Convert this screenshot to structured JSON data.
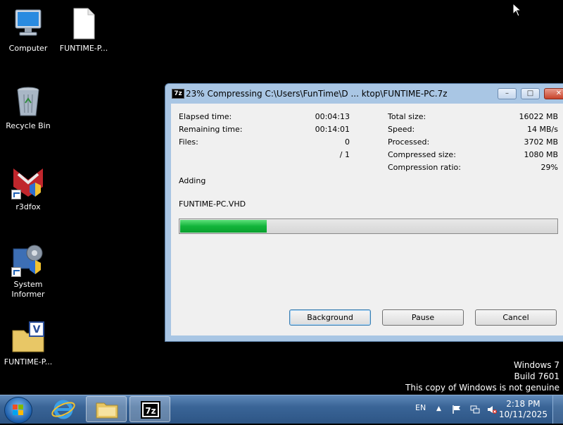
{
  "desktop": {
    "icons": [
      {
        "label": "Computer",
        "icon": "computer-icon"
      },
      {
        "label": "FUNTIME-P...",
        "icon": "blank-file-icon"
      },
      {
        "label": "Recycle Bin",
        "icon": "recycle-bin-icon"
      },
      {
        "label": "r3dfox",
        "icon": "r3dfox-icon"
      },
      {
        "label_line1": "System",
        "label_line2": "Informer",
        "icon": "system-informer-icon"
      },
      {
        "label": "FUNTIME-P...",
        "icon": "vhd-file-icon"
      }
    ],
    "watermark": {
      "line1": "Windows 7",
      "line2": "Build 7601",
      "line3": "This copy of Windows is not genuine"
    }
  },
  "window": {
    "app_icon_text": "7z",
    "title": "23% Compressing C:\\Users\\FunTime\\D ... ktop\\FUNTIME-PC.7z",
    "stats_left": [
      {
        "label": "Elapsed time:",
        "value": "00:04:13"
      },
      {
        "label": "Remaining time:",
        "value": "00:14:01"
      },
      {
        "label": "Files:",
        "value": "0"
      },
      {
        "label": "",
        "value": "/ 1"
      }
    ],
    "stats_right": [
      {
        "label": "Total size:",
        "value": "16022 MB"
      },
      {
        "label": "Speed:",
        "value": "14 MB/s"
      },
      {
        "label": "Processed:",
        "value": "3702 MB"
      },
      {
        "label": "Compressed size:",
        "value": "1080 MB"
      },
      {
        "label": "Compression ratio:",
        "value": "29%"
      }
    ],
    "status": "Adding",
    "current_file": "FUNTIME-PC.VHD",
    "progress_fraction": 0.23,
    "buttons": {
      "background": "Background",
      "pause": "Pause",
      "cancel": "Cancel"
    }
  },
  "taskbar": {
    "language": "EN",
    "time": "2:18 PM",
    "date": "10/11/2025",
    "items": [
      "internet-explorer-icon",
      "explorer-folder-icon",
      "7zip-icon"
    ]
  },
  "colors": {
    "desktop_bg": "#000000",
    "progress_fill": "#12b43a",
    "taskbar": "#3a6597"
  }
}
